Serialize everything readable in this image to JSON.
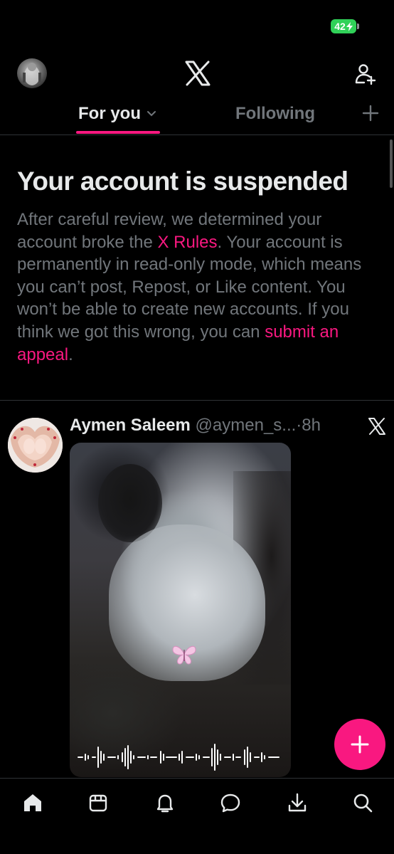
{
  "status_bar": {
    "battery_level": "42",
    "battery_color": "#30d158",
    "charging_icon": "bolt-icon"
  },
  "header": {
    "avatar_icon": "profile-avatar",
    "logo_icon": "x-logo-icon",
    "follow_icon": "add-user-icon"
  },
  "tabs": {
    "for_you": "For you",
    "following": "Following",
    "active": "For you",
    "add_icon": "plus-icon"
  },
  "notice": {
    "title": "Your account is suspended",
    "body_part1": "After careful review, we determined your account broke the ",
    "rules_link": "X Rules",
    "body_part2": ". Your account is permanently in read-only mode, which means you can’t post, Repost, or Like content. You won’t be able to create new accounts. If you think we got this wrong, you can ",
    "appeal_link": "submit an appeal",
    "body_end": "."
  },
  "tweet": {
    "name": "Aymen Saleem",
    "handle": "@aymen_s...",
    "separator": "·",
    "time": "8h",
    "source_icon": "x-logo-icon",
    "media": {
      "type": "video",
      "sticker_icon": "butterfly-icon",
      "overlay_icon": "audio-waveform-icon"
    }
  },
  "fab": {
    "icon": "plus-icon",
    "color": "#f91880"
  },
  "bottom_nav": [
    "home-icon",
    "grok-icon",
    "notifications-icon",
    "messages-icon",
    "download-icon",
    "search-icon"
  ],
  "colors": {
    "accent": "#f91880",
    "text_primary": "#e7e9ea",
    "text_secondary": "#71767b",
    "divider": "#2f3336",
    "background": "#000000"
  }
}
